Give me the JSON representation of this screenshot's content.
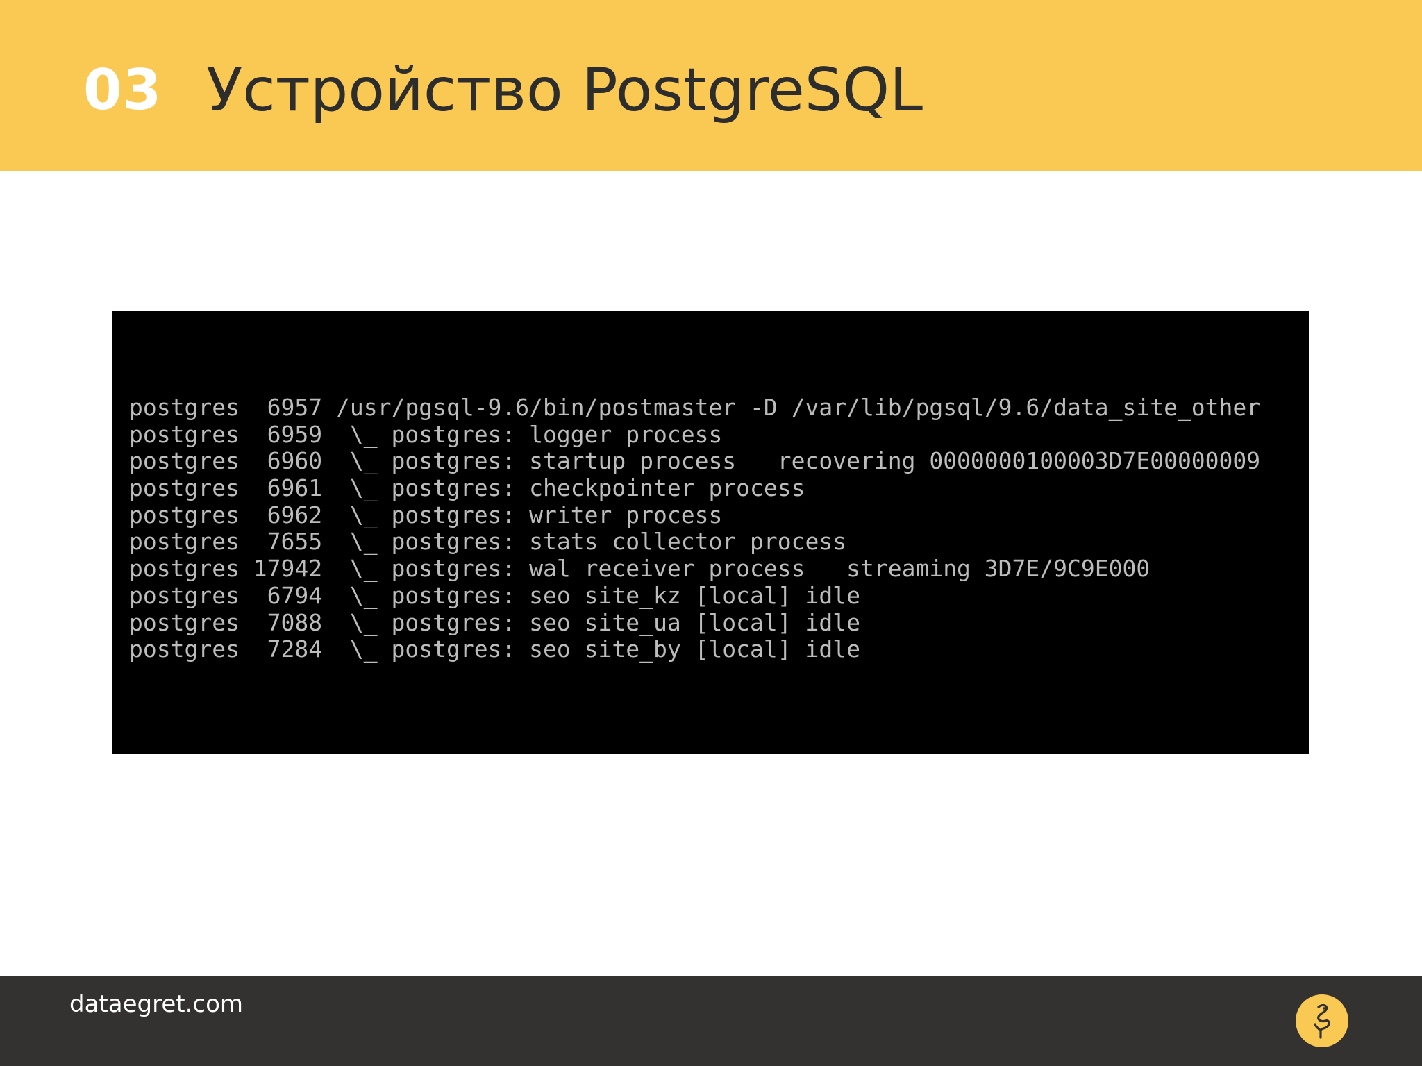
{
  "slide": {
    "number": "03",
    "title": "Устройство PostgreSQL"
  },
  "terminal": {
    "lines": [
      "postgres  6957 /usr/pgsql-9.6/bin/postmaster -D /var/lib/pgsql/9.6/data_site_other",
      "postgres  6959  \\_ postgres: logger process",
      "postgres  6960  \\_ postgres: startup process   recovering 0000000100003D7E00000009",
      "postgres  6961  \\_ postgres: checkpointer process",
      "postgres  6962  \\_ postgres: writer process",
      "postgres  7655  \\_ postgres: stats collector process",
      "postgres 17942  \\_ postgres: wal receiver process   streaming 3D7E/9C9E000",
      "postgres  6794  \\_ postgres: seo site_kz [local] idle",
      "postgres  7088  \\_ postgres: seo site_ua [local] idle",
      "postgres  7284  \\_ postgres: seo site_by [local] idle"
    ]
  },
  "footer": {
    "site": "dataegret.com",
    "logo_icon": "dataegret-logo-icon"
  },
  "colors": {
    "header_bg": "#f9c954",
    "footer_bg": "#333230",
    "terminal_bg": "#000000",
    "terminal_text": "#bcbcbc",
    "title_text": "#2d2d2d"
  }
}
